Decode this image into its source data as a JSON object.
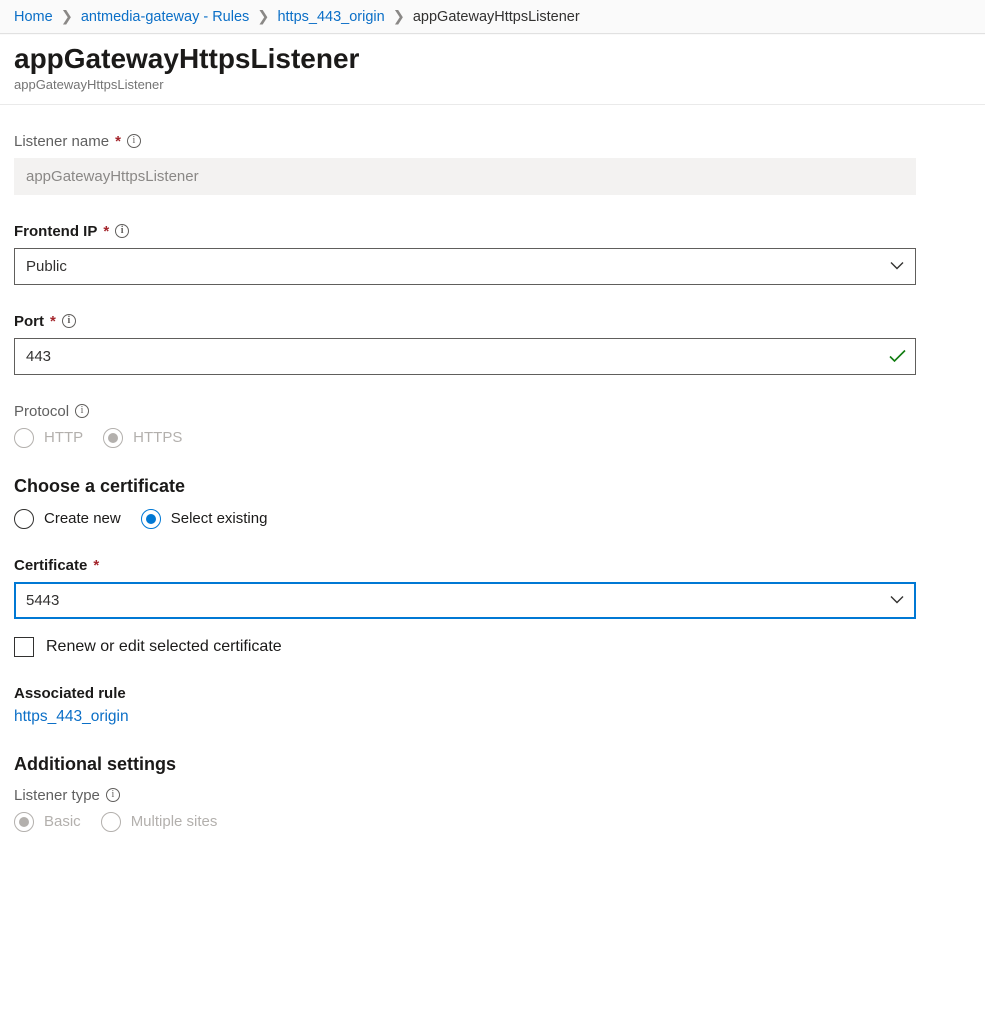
{
  "breadcrumbs": {
    "items": [
      {
        "label": "Home"
      },
      {
        "label": "antmedia-gateway - Rules"
      },
      {
        "label": "https_443_origin"
      }
    ],
    "current": "appGatewayHttpsListener"
  },
  "header": {
    "title": "appGatewayHttpsListener",
    "subtitle": "appGatewayHttpsListener"
  },
  "fields": {
    "listener_name": {
      "label": "Listener name",
      "value": "appGatewayHttpsListener"
    },
    "frontend_ip": {
      "label": "Frontend IP",
      "value": "Public"
    },
    "port": {
      "label": "Port",
      "value": "443"
    },
    "protocol": {
      "label": "Protocol",
      "options": {
        "http": "HTTP",
        "https": "HTTPS"
      }
    },
    "choose_cert": {
      "label": "Choose a certificate",
      "options": {
        "create": "Create new",
        "select": "Select existing"
      }
    },
    "certificate": {
      "label": "Certificate",
      "value": "5443"
    },
    "renew": {
      "label": "Renew or edit selected certificate"
    },
    "assoc_rule": {
      "label": "Associated rule",
      "link": "https_443_origin"
    },
    "additional": {
      "heading": "Additional settings"
    },
    "listener_type": {
      "label": "Listener type",
      "options": {
        "basic": "Basic",
        "multi": "Multiple sites"
      }
    }
  }
}
